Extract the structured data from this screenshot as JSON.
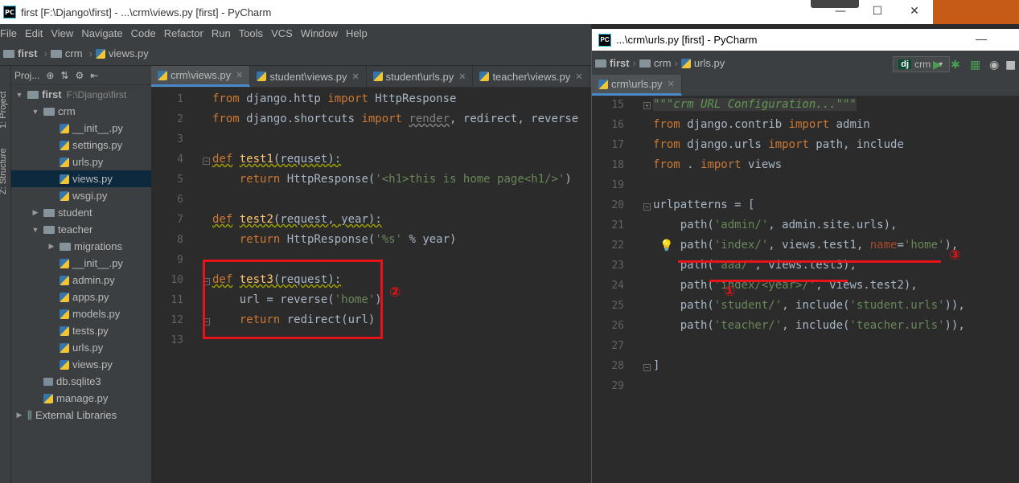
{
  "main_window": {
    "title": "first [F:\\Django\\first] - ...\\crm\\views.py [first] - PyCharm",
    "logo": "PC",
    "controls": [
      "—",
      "☐",
      "✕"
    ]
  },
  "menu": [
    "File",
    "Edit",
    "View",
    "Navigate",
    "Code",
    "Refactor",
    "Run",
    "Tools",
    "VCS",
    "Window",
    "Help"
  ],
  "breadcrumb": [
    "first",
    "crm",
    "views.py"
  ],
  "side_tabs": [
    "1: Project",
    "Z: Structure"
  ],
  "project_panel": {
    "header": "Proj...",
    "tree": [
      {
        "label": "first",
        "extra": "F:\\Django\\first",
        "indent": 0,
        "kind": "folder",
        "open": true
      },
      {
        "label": "crm",
        "indent": 1,
        "kind": "folder",
        "open": true
      },
      {
        "label": "__init__.py",
        "indent": 2,
        "kind": "py"
      },
      {
        "label": "settings.py",
        "indent": 2,
        "kind": "py"
      },
      {
        "label": "urls.py",
        "indent": 2,
        "kind": "py"
      },
      {
        "label": "views.py",
        "indent": 2,
        "kind": "py",
        "selected": true
      },
      {
        "label": "wsgi.py",
        "indent": 2,
        "kind": "py"
      },
      {
        "label": "student",
        "indent": 1,
        "kind": "folder",
        "open": false
      },
      {
        "label": "teacher",
        "indent": 1,
        "kind": "folder",
        "open": true
      },
      {
        "label": "migrations",
        "indent": 2,
        "kind": "folder",
        "open": false
      },
      {
        "label": "__init__.py",
        "indent": 2,
        "kind": "py"
      },
      {
        "label": "admin.py",
        "indent": 2,
        "kind": "py"
      },
      {
        "label": "apps.py",
        "indent": 2,
        "kind": "py"
      },
      {
        "label": "models.py",
        "indent": 2,
        "kind": "py"
      },
      {
        "label": "tests.py",
        "indent": 2,
        "kind": "py"
      },
      {
        "label": "urls.py",
        "indent": 2,
        "kind": "py"
      },
      {
        "label": "views.py",
        "indent": 2,
        "kind": "py"
      },
      {
        "label": "db.sqlite3",
        "indent": 1,
        "kind": "db"
      },
      {
        "label": "manage.py",
        "indent": 1,
        "kind": "py"
      },
      {
        "label": "External Libraries",
        "indent": 0,
        "kind": "lib",
        "open": false
      }
    ]
  },
  "editor1": {
    "tabs": [
      "crm\\views.py",
      "student\\views.py",
      "student\\urls.py",
      "teacher\\views.py"
    ],
    "active_tab": 0,
    "line_numbers": [
      "1",
      "2",
      "3",
      "4",
      "5",
      "6",
      "7",
      "8",
      "9",
      "10",
      "11",
      "12",
      "13"
    ]
  },
  "second_window": {
    "title": "...\\crm\\urls.py [first] - PyCharm",
    "breadcrumb": [
      "first",
      "crm",
      "urls.py"
    ],
    "run_config": "crm",
    "tab": "crm\\urls.py",
    "line_numbers": [
      "15",
      "16",
      "17",
      "18",
      "19",
      "20",
      "21",
      "22",
      "23",
      "24",
      "25",
      "26",
      "27",
      "28",
      "29"
    ]
  },
  "annotations": [
    "②",
    "③",
    "①"
  ],
  "colors": {
    "keyword": "#cc7832",
    "string": "#6a8759",
    "function": "#ffc66d",
    "annotation": "#e8141a",
    "default": "#a9b7c6"
  }
}
